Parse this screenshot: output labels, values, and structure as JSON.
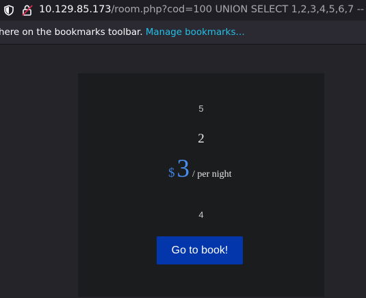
{
  "browser": {
    "url_host": "10.129.85.173",
    "url_path": "/room.php?cod=100 UNION SELECT 1,2,3,4,5,6,7 -- -",
    "bookmarks_bar_message": "here on the bookmarks toolbar.",
    "bookmarks_bar_link": "Manage bookmarks…"
  },
  "room": {
    "field_top": "5",
    "name": "2",
    "currency_symbol": "$",
    "price": "3",
    "price_unit": "/ per night",
    "field_bottom": "4",
    "book_button_label": "Go to book!"
  },
  "colors": {
    "page_background": "#252529",
    "card_background": "#1b1c1e",
    "price_accent": "#4a8df0",
    "button_background": "#0336aa",
    "link_color": "#23c0e8"
  }
}
